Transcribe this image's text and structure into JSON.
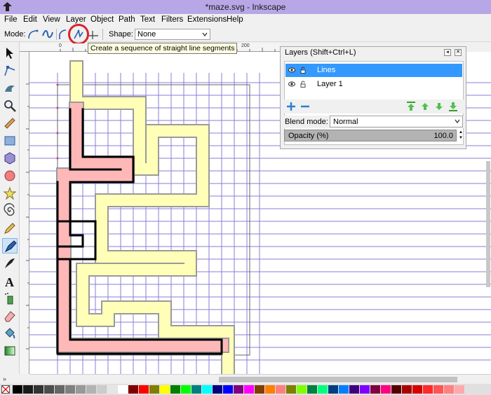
{
  "window": {
    "title": "*maze.svg - Inkscape"
  },
  "menu": [
    "File",
    "Edit",
    "View",
    "Layer",
    "Object",
    "Path",
    "Text",
    "Filters",
    "Extensions",
    "Help"
  ],
  "controls": {
    "mode_label": "Mode:",
    "shape_label": "Shape:",
    "shape_value": "None",
    "tooltip": "Create a sequence of straight line segments"
  },
  "ruler": {
    "h_labels": [
      "0",
      "200"
    ]
  },
  "layers": {
    "title": "Layers (Shift+Ctrl+L)",
    "items": [
      {
        "name": "Lines",
        "selected": true
      },
      {
        "name": "Layer 1",
        "selected": false
      }
    ],
    "blend_label": "Blend mode:",
    "blend_value": "Normal",
    "opacity_label": "Opacity (%)",
    "opacity_value": "100.0"
  },
  "colors": {
    "maze_path_fill": "#ffffb8",
    "maze_solution_fill": "#ffb8b8",
    "grid_line": "#7a6bd2",
    "selection_highlight": "#3399ff",
    "tooltip_bg": "#ffffe1",
    "annotation_ring": "#d8242b"
  },
  "palette": [
    "#000000",
    "#1a1a1a",
    "#333333",
    "#4d4d4d",
    "#666666",
    "#808080",
    "#999999",
    "#b3b3b3",
    "#cccccc",
    "#e6e6e6",
    "#ffffff",
    "#800000",
    "#ff0000",
    "#808000",
    "#ffff00",
    "#008000",
    "#00ff00",
    "#008080",
    "#00ffff",
    "#000080",
    "#0000ff",
    "#800080",
    "#ff00ff",
    "#7f3f00",
    "#ff7f00",
    "#ff7f7f",
    "#7f7f00",
    "#7fff00",
    "#007f3f",
    "#00ff7f",
    "#003f7f",
    "#007fff",
    "#3f007f",
    "#7f00ff",
    "#7f003f",
    "#ff007f",
    "#550000",
    "#aa0000",
    "#d40000",
    "#ff2a2a",
    "#ff5555",
    "#ff8080",
    "#ffaaaa"
  ]
}
